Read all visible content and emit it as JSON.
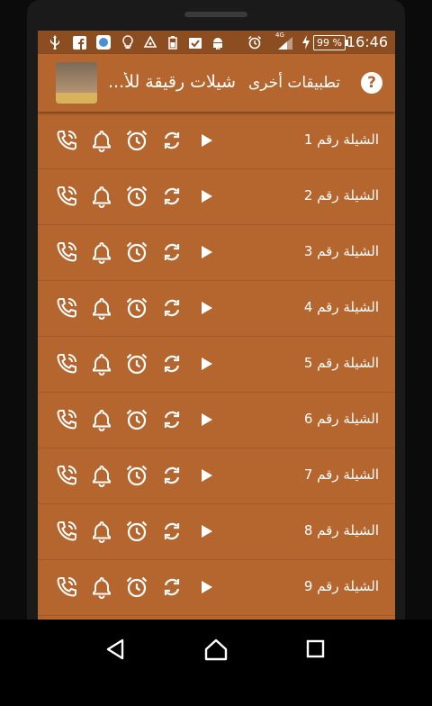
{
  "status_bar": {
    "time": "16:46",
    "battery_percent": "99 %",
    "network": "4G"
  },
  "toolbar": {
    "app_title": "شيلات رقيقة للأ...",
    "other_apps_label": "تطبيقات أخرى",
    "help_label": "?"
  },
  "list": {
    "items": [
      {
        "label": "الشيلة رقم 1"
      },
      {
        "label": "الشيلة رقم 2"
      },
      {
        "label": "الشيلة رقم 3"
      },
      {
        "label": "الشيلة رقم 4"
      },
      {
        "label": "الشيلة رقم 5"
      },
      {
        "label": "الشيلة رقم 6"
      },
      {
        "label": "الشيلة رقم 7"
      },
      {
        "label": "الشيلة رقم 8"
      },
      {
        "label": "الشيلة رقم 9"
      }
    ],
    "actions": [
      "ringtone-call-icon",
      "notification-bell-icon",
      "alarm-clock-icon",
      "repeat-icon",
      "play-icon"
    ]
  },
  "colors": {
    "background": "#b5662e",
    "status_bar": "#8c4e21",
    "divider": "#a55a26"
  }
}
